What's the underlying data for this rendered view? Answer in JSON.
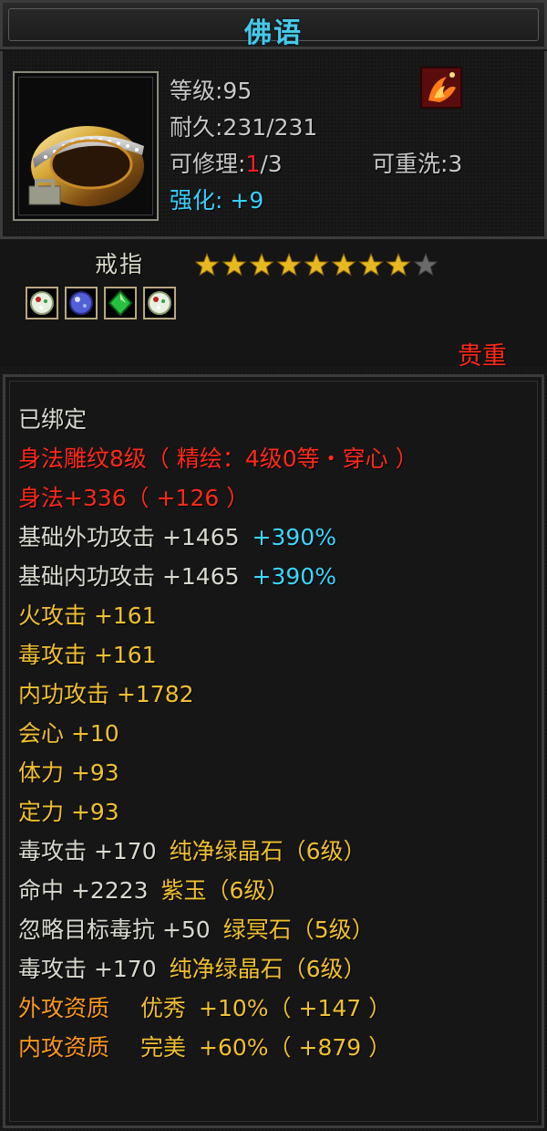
{
  "title": "佛语",
  "stats": {
    "level": "等级:95",
    "durability": "耐久:231/231",
    "repair_prefix": "可修理:",
    "repair_current": "1",
    "repair_suffix": "/3",
    "reforge": "可重洗:3",
    "strength": "强化: +9"
  },
  "item": {
    "type_name": "戒指",
    "stars_filled": 8,
    "stars_total": 9,
    "quality": "贵重",
    "gems": [
      "white-gem-icon",
      "blue-gem-icon",
      "green-gem-icon",
      "white-gem-icon"
    ]
  },
  "attributes": [
    {
      "text": "已绑定",
      "color": "white"
    },
    {
      "text": "身法雕纹8级（ 精绘：4级0等・穿心 ）",
      "color": "red"
    },
    {
      "text": "身法+336（ +126 ）",
      "color": "red"
    },
    {
      "text": "基础外功攻击  +1465",
      "extra": "+390%",
      "color": "white"
    },
    {
      "text": "基础内功攻击  +1465",
      "extra": "+390%",
      "color": "white"
    },
    {
      "text": "火攻击  +161",
      "color": "yellow"
    },
    {
      "text": "毒攻击  +161",
      "color": "yellow"
    },
    {
      "text": "内功攻击  +1782",
      "color": "yellow"
    },
    {
      "text": "会心  +10",
      "color": "yellow"
    },
    {
      "text": "体力  +93",
      "color": "yellow"
    },
    {
      "text": "定力  +93",
      "color": "yellow"
    },
    {
      "text": "毒攻击  +170",
      "gem": "纯净绿晶石（6级）",
      "color": "white"
    },
    {
      "text": "命中  +2223",
      "gem": "紫玉（6级）",
      "color": "white"
    },
    {
      "text": "忽略目标毒抗  +50",
      "gem": "绿冥石（5级）",
      "color": "white"
    },
    {
      "text": "毒攻击  +170",
      "gem": "纯净绿晶石（6级）",
      "color": "white"
    },
    {
      "text": "外攻资质",
      "rating": "优秀",
      "value": "+10%（ +147 ）",
      "color": "orange"
    },
    {
      "text": "内攻资质",
      "rating": "完美",
      "value": "+60%（ +879 ）",
      "color": "orange"
    }
  ],
  "colors": {
    "title": "#48c8e8",
    "red": "#ff2a1a",
    "yellow": "#f0c030",
    "orange": "#ff9a1a",
    "cyan": "#3ad8ff",
    "white": "#d9d9d0"
  }
}
